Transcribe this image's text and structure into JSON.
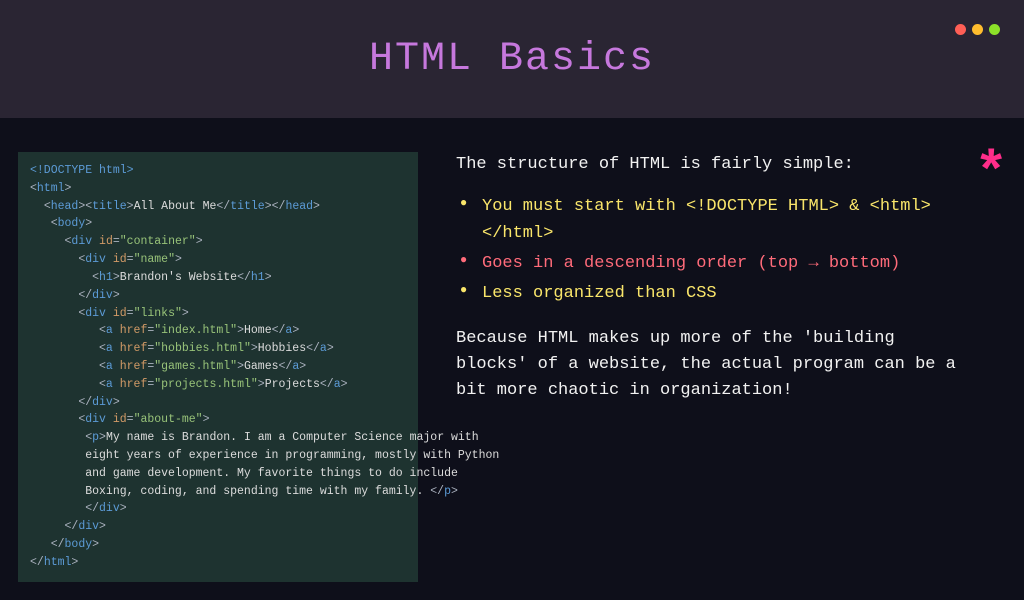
{
  "header": {
    "title": "HTML Basics"
  },
  "code": {
    "doctype": "<!DOCTYPE html>",
    "html_open": "html",
    "head_open": "head",
    "title_open": "title",
    "title_text": "All About Me",
    "body": "body",
    "div": "div",
    "id_attr": "id",
    "container": "\"container\"",
    "name_id": "\"name\"",
    "h1": "h1",
    "h1_text": "Brandon's Website",
    "links_id": "\"links\"",
    "a": "a",
    "href": "href",
    "index": "\"index.html\"",
    "home": "Home",
    "hobbies_href": "\"hobbies.html\"",
    "hobbies": "Hobbies",
    "games_href": "\"games.html\"",
    "games": "Games",
    "projects_href": "\"projects.html\"",
    "projects": "Projects",
    "about_id": "\"about-me\"",
    "p": "p",
    "para": "My name is Brandon. I am a Computer Science major with eight years of experience in programming, mostly with Python and game development. My favorite things to do include Boxing, coding, and spending time with my family. "
  },
  "right": {
    "intro": "The structure of HTML is fairly simple:",
    "bullet1": "You must start with <!DOCTYPE HTML> & <html></html>",
    "bullet2": "Goes in a descending order (top → bottom)",
    "bullet3": "Less organized than CSS",
    "outro": "Because HTML makes up more of the 'building blocks' of a website, the actual program can be a bit more chaotic in organization!",
    "asterisk": "*"
  }
}
